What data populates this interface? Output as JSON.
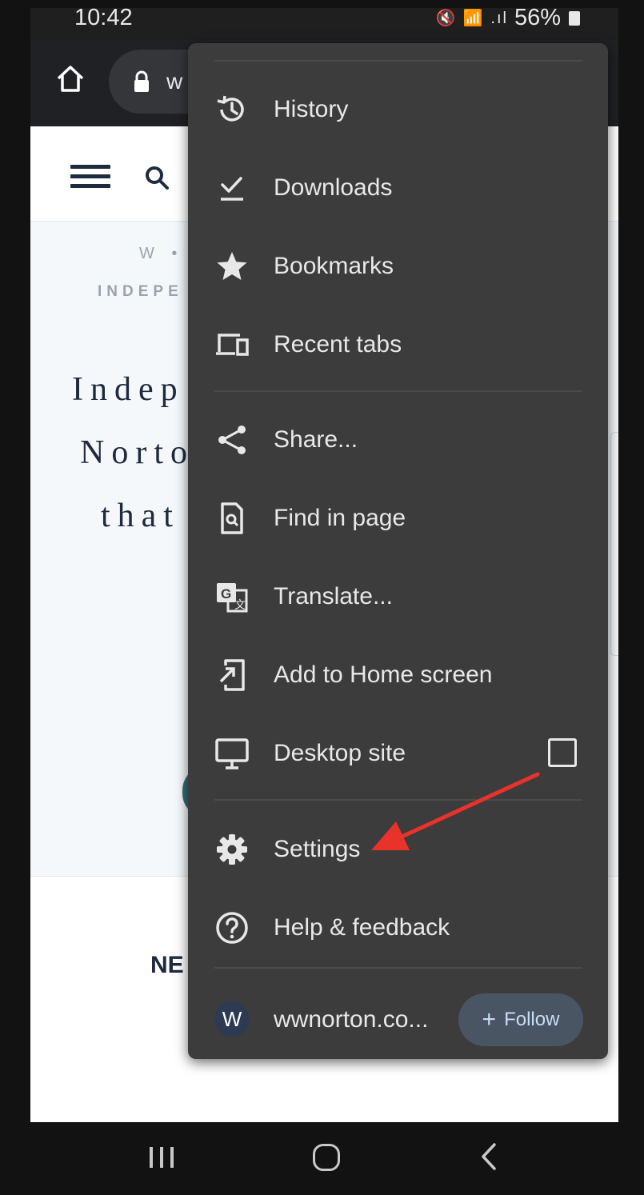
{
  "status_bar": {
    "time": "10:42",
    "icons": "🔇 📶 .ıl",
    "battery": "56%"
  },
  "toolbar": {
    "url_partial": "w"
  },
  "page": {
    "kicker": "W •",
    "kicker2": "INDEPE",
    "headline_lines": [
      "Indep",
      "Norto",
      "that"
    ],
    "news": "NE"
  },
  "menu": {
    "items": [
      {
        "label": "History",
        "icon": "history-icon"
      },
      {
        "label": "Downloads",
        "icon": "downloads-icon"
      },
      {
        "label": "Bookmarks",
        "icon": "star-icon"
      },
      {
        "label": "Recent tabs",
        "icon": "devices-icon"
      },
      {
        "label": "Share...",
        "icon": "share-icon"
      },
      {
        "label": "Find in page",
        "icon": "find-in-page-icon"
      },
      {
        "label": "Translate...",
        "icon": "translate-icon"
      },
      {
        "label": "Add to Home screen",
        "icon": "add-to-home-icon"
      },
      {
        "label": "Desktop site",
        "icon": "monitor-icon",
        "checked": false
      },
      {
        "label": "Settings",
        "icon": "gear-icon"
      },
      {
        "label": "Help & feedback",
        "icon": "help-icon"
      }
    ],
    "site": {
      "avatar_letter": "W",
      "label": "wwnorton.co...",
      "follow_plus": "+",
      "follow_label": "Follow"
    }
  },
  "colors": {
    "menu_bg": "#3c3c3c",
    "arrow": "#e8322a",
    "follow_bg": "#4a5563",
    "follow_text": "#c9dcf5"
  }
}
